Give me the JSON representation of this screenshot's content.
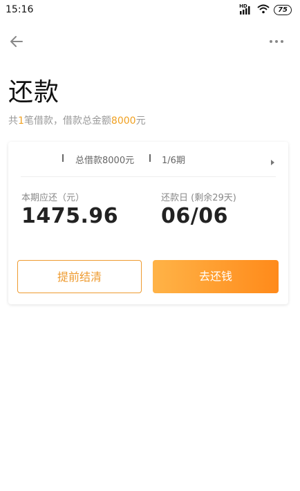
{
  "status_bar": {
    "time": "15:16",
    "network_label": "HD",
    "battery": "75",
    "icons": [
      "signal-icon",
      "wifi-icon",
      "battery-icon"
    ]
  },
  "topbar": {
    "back_icon": "arrow-left-icon",
    "more_icon": "more-dots-icon"
  },
  "page": {
    "title": "还款",
    "summary": {
      "prefix": "共",
      "count": "1",
      "middle": "笔借款，借款总金额",
      "amount": "8000",
      "suffix": "元"
    }
  },
  "card": {
    "total_loan": "总借款8000元",
    "period": "1/6期",
    "due_label": "本期应还（元）",
    "due_amount": "1475.96",
    "date_label": "还款日 (剩余29天)",
    "due_date": "06/06",
    "prepay_button": "提前结清",
    "repay_button": "去还钱"
  },
  "colors": {
    "accent": "#ee9a2e",
    "gradient_start": "#ffb347",
    "gradient_end": "#ff8a1a",
    "highlight": "#f0a020"
  }
}
